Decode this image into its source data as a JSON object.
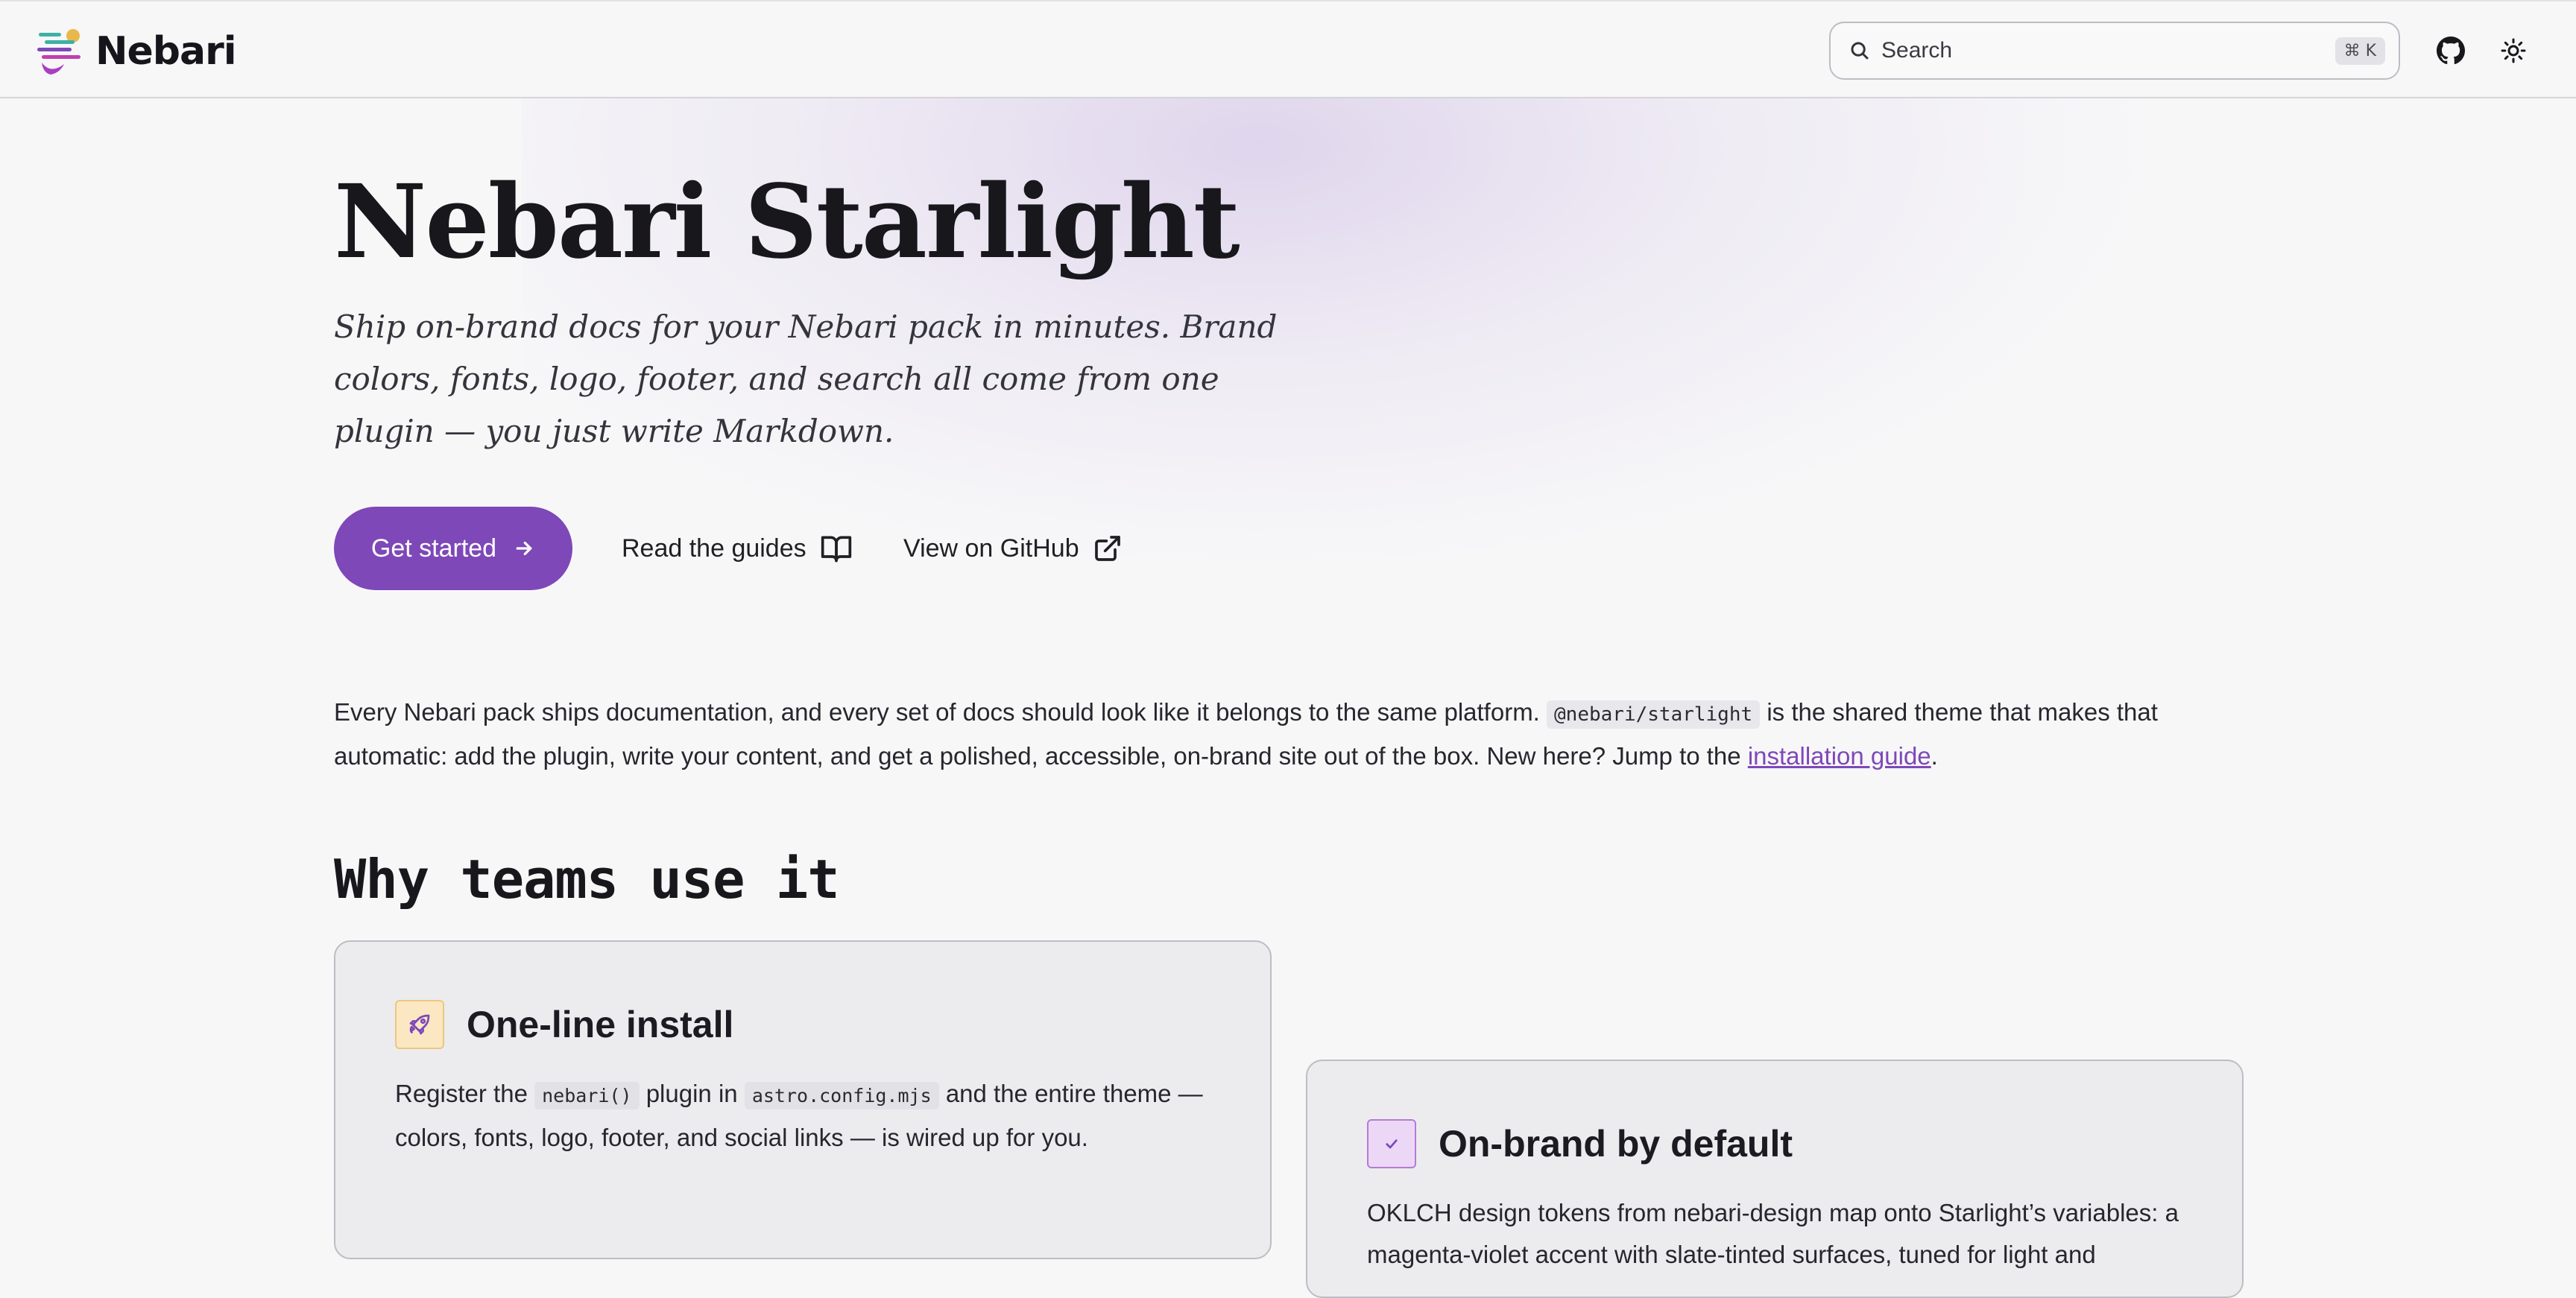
{
  "header": {
    "brand_name": "Nebari",
    "search_placeholder": "Search",
    "search_shortcut": "⌘ K",
    "icons": {
      "search": "search-icon",
      "github": "github-icon",
      "theme": "sun-icon"
    }
  },
  "hero": {
    "title": "Nebari Starlight",
    "tagline": "Ship on-brand docs for your Nebari pack in minutes. Brand colors, fonts, logo, footer, and search all come from one plugin — you just write Markdown.",
    "primary_action": "Get started",
    "guides_action": "Read the guides",
    "github_action": "View on GitHub"
  },
  "intro": {
    "text_1": "Every Nebari pack ships documentation, and every set of docs should look like it belongs to the same platform.",
    "code": "@nebari/starlight",
    "text_2": "is the shared theme that makes that automatic: add the plugin, write your content, and get a polished, accessible, on-brand site out of the box. New here? Jump to the",
    "link": "installation guide",
    "text_3": "."
  },
  "section": {
    "title": "Why teams use it"
  },
  "cards": [
    {
      "title": "One-line install",
      "icon": "rocket-icon",
      "body_1": "Register the",
      "code_1": "nebari()",
      "body_2": "plugin in",
      "code_2": "astro.config.mjs",
      "body_3": "and the entire theme — colors, fonts, logo, footer, and social links — is wired up for you."
    },
    {
      "title": "On-brand by default",
      "icon": "check-icon",
      "body": "OKLCH design tokens from nebari-design map onto Starlight’s variables: a magenta-violet accent with slate-tinted surfaces, tuned for light and"
    }
  ],
  "colors": {
    "accent": "#7e48b8",
    "background": "#f7f7f8",
    "card_background": "#ececef",
    "text": "#1f1f24"
  }
}
